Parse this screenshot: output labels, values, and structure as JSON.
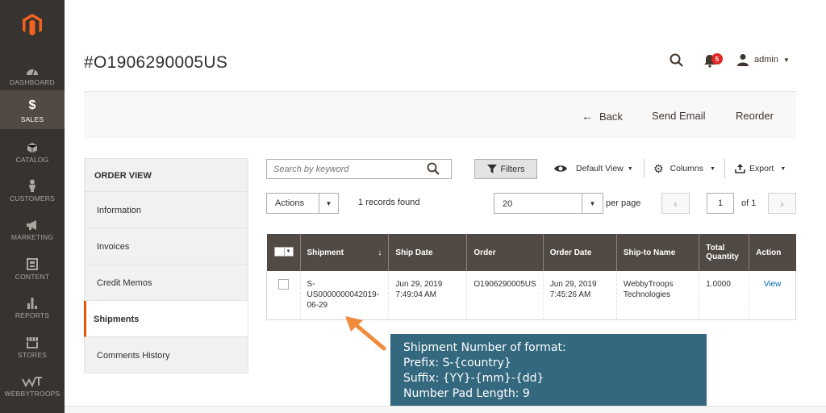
{
  "sidebar": {
    "items": [
      {
        "label": "DASHBOARD",
        "icon": "dashboard-icon"
      },
      {
        "label": "SALES",
        "icon": "dollar-icon",
        "active": true
      },
      {
        "label": "CATALOG",
        "icon": "cube-icon"
      },
      {
        "label": "CUSTOMERS",
        "icon": "person-icon"
      },
      {
        "label": "MARKETING",
        "icon": "megaphone-icon"
      },
      {
        "label": "CONTENT",
        "icon": "content-icon"
      },
      {
        "label": "REPORTS",
        "icon": "bar-chart-icon"
      },
      {
        "label": "STORES",
        "icon": "store-icon"
      },
      {
        "label": "WEBBYTROOPS",
        "icon": "webbytroops-icon"
      }
    ],
    "sales_symbol": "$"
  },
  "header": {
    "title": "#O1906290005US",
    "notifications_count": "5",
    "user": "admin"
  },
  "action_bar": {
    "back": "Back",
    "send_email": "Send Email",
    "reorder": "Reorder"
  },
  "tabs": {
    "heading": "ORDER VIEW",
    "items": [
      "Information",
      "Invoices",
      "Credit Memos",
      "Shipments",
      "Comments History"
    ],
    "active": "Shipments"
  },
  "grid_controls": {
    "search_placeholder": "Search by keyword",
    "filters": "Filters",
    "default_view": "Default View",
    "columns": "Columns",
    "export": "Export",
    "actions": "Actions",
    "records_found": "1 records found",
    "per_page_value": "20",
    "per_page_label": "per page",
    "page": "1",
    "of_pages": "of 1"
  },
  "table": {
    "headers": [
      "Shipment",
      "Ship Date",
      "Order",
      "Order Date",
      "Ship-to Name",
      "Total Quantity",
      "Action"
    ],
    "sort_indicator": "↓",
    "rows": [
      {
        "shipment": "S-US0000000042019-06-29",
        "shipment_lines": [
          "S-",
          "US0000000042019-",
          "06-29"
        ],
        "ship_date": [
          "Jun 29, 2019",
          "7:49:04 AM"
        ],
        "order": "O1906290005US",
        "order_date": [
          "Jun 29, 2019",
          "7:45:26 AM"
        ],
        "ship_to": [
          "WebbyTroops",
          "Technologies"
        ],
        "total_qty": "1.0000",
        "action": "View"
      }
    ]
  },
  "callout": {
    "lines": [
      "Shipment Number of format:",
      "Prefix: S-{country}",
      "Suffix: {YY}-{mm}-{dd}",
      "Number Pad Length: 9"
    ]
  },
  "colors": {
    "sidebar_bg": "#373330",
    "sidebar_active": "#514943",
    "accent": "#eb5202",
    "table_header": "#514943",
    "callout_bg": "#33687e",
    "arrow": "#f08a3c",
    "link": "#006bb4",
    "badge": "#e22626"
  }
}
